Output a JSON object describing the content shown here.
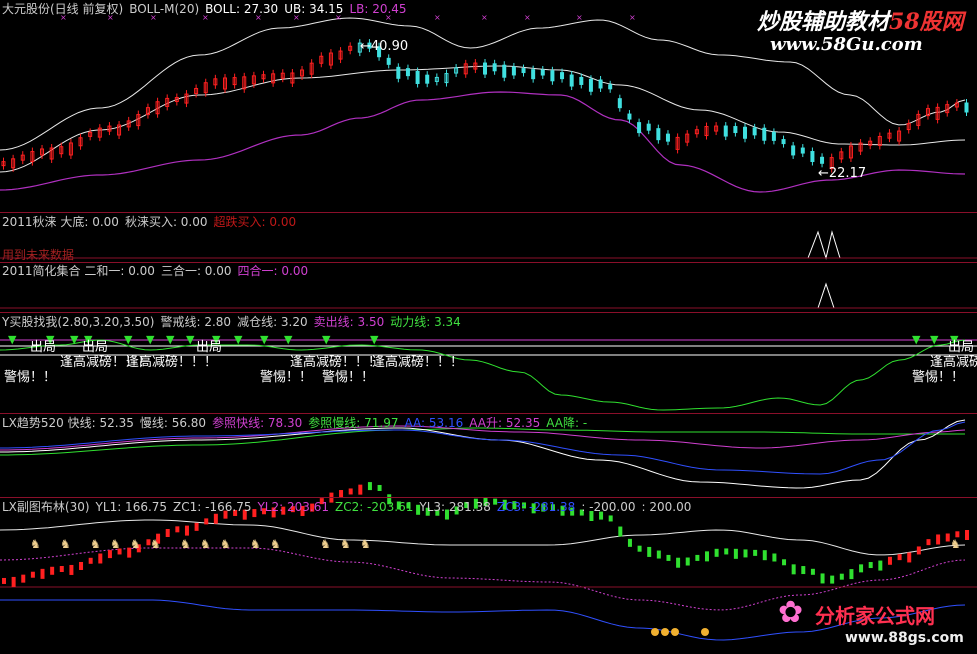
{
  "panels": [
    {
      "id": "main",
      "items": [
        {
          "text": "大元股份(日线 前复权)",
          "color": "#cccccc"
        },
        {
          "text": "BOLL-M(20)",
          "color": "#cccccc"
        },
        {
          "text": "BOLL: 27.30",
          "color": "#ffffff"
        },
        {
          "text": "UB: 34.15",
          "color": "#ffffff"
        },
        {
          "text": "LB: 20.45",
          "color": "#d040d0"
        }
      ]
    },
    {
      "id": "p2",
      "items": [
        {
          "text": "2011秋涞 大底: 0.00",
          "color": "#cccccc"
        },
        {
          "text": "秋涞买入: 0.00",
          "color": "#cccccc"
        },
        {
          "text": "超跌买入: 0.00",
          "color": "#c01818"
        }
      ]
    },
    {
      "id": "p2b",
      "items": [
        {
          "text": "用到未来数据",
          "color": "#a02020"
        }
      ]
    },
    {
      "id": "p3",
      "items": [
        {
          "text": "2011简化集合 二和一: 0.00",
          "color": "#cccccc"
        },
        {
          "text": "三合一: 0.00",
          "color": "#cccccc"
        },
        {
          "text": "四合一: 0.00",
          "color": "#d040d0"
        }
      ]
    },
    {
      "id": "p4",
      "items": [
        {
          "text": "Y买股找我(2.80,3.20,3.50)",
          "color": "#cccccc"
        },
        {
          "text": "警戒线: 2.80",
          "color": "#cccccc"
        },
        {
          "text": "减仓线: 3.20",
          "color": "#cccccc"
        },
        {
          "text": "卖出线: 3.50",
          "color": "#d040d0"
        },
        {
          "text": "动力线: 3.34",
          "color": "#40e040"
        }
      ]
    },
    {
      "id": "p5",
      "items": [
        {
          "text": "LX趋势520 快线: 52.35",
          "color": "#cccccc"
        },
        {
          "text": "慢线: 56.80",
          "color": "#cccccc"
        },
        {
          "text": "参照快线: 78.30",
          "color": "#d040d0"
        },
        {
          "text": "参照慢线: 71.97",
          "color": "#40e040"
        },
        {
          "text": "AA: 53.16",
          "color": "#3050ff"
        },
        {
          "text": "AA升: 52.35",
          "color": "#d040d0"
        },
        {
          "text": "AA降: -",
          "color": "#40e040"
        }
      ]
    },
    {
      "id": "p6",
      "items": [
        {
          "text": "LX副图布林(30)",
          "color": "#cccccc"
        },
        {
          "text": "YL1: 166.75",
          "color": "#cccccc"
        },
        {
          "text": "ZC1: -166.75",
          "color": "#cccccc"
        },
        {
          "text": "YL2: 203.61",
          "color": "#d040d0"
        },
        {
          "text": "ZC2: -203.61",
          "color": "#40e040"
        },
        {
          "text": "YL3: 281.38",
          "color": "#cccccc"
        },
        {
          "text": "ZC3: -281.38",
          "color": "#3050ff"
        },
        {
          "text": ": -200.00",
          "color": "#cccccc"
        },
        {
          "text": ": 200.00",
          "color": "#cccccc"
        }
      ]
    }
  ],
  "watermark": {
    "top": "炒股辅助教材",
    "top_accent": "58股网",
    "url1": "www.58Gu.com",
    "site": "分析家公式网",
    "url2": "www.88gs.com"
  },
  "annotations": {
    "high": "←40.90",
    "low": "←22.17",
    "out": "出局",
    "peak": "逢高减磅！！！",
    "warn": "警惕！！"
  },
  "chart_data": [
    {
      "type": "candlestick",
      "panel": "BOLL-M(20)",
      "series": [
        {
          "name": "BOLL",
          "value": 27.3
        },
        {
          "name": "UB",
          "value": 34.15
        },
        {
          "name": "LB",
          "value": 20.45
        }
      ],
      "price_marks": {
        "high": 40.9,
        "low": 22.17
      }
    },
    {
      "type": "line",
      "panel": "2011秋涞",
      "series": [
        {
          "name": "大底",
          "value": 0.0
        },
        {
          "name": "秋涞买入",
          "value": 0.0
        },
        {
          "name": "超跌买入",
          "value": 0.0
        }
      ]
    },
    {
      "type": "line",
      "panel": "2011简化集合",
      "series": [
        {
          "name": "二和一",
          "value": 0.0
        },
        {
          "name": "三合一",
          "value": 0.0
        },
        {
          "name": "四合一",
          "value": 0.0
        }
      ]
    },
    {
      "type": "line",
      "panel": "Y买股找我",
      "params": [
        2.8,
        3.2,
        3.5
      ],
      "series": [
        {
          "name": "警戒线",
          "value": 2.8
        },
        {
          "name": "减仓线",
          "value": 3.2
        },
        {
          "name": "卖出线",
          "value": 3.5
        },
        {
          "name": "动力线",
          "value": 3.34
        }
      ]
    },
    {
      "type": "line",
      "panel": "LX趋势520",
      "series": [
        {
          "name": "快线",
          "value": 52.35
        },
        {
          "name": "慢线",
          "value": 56.8
        },
        {
          "name": "参照快线",
          "value": 78.3
        },
        {
          "name": "参照慢线",
          "value": 71.97
        },
        {
          "name": "AA",
          "value": 53.16
        },
        {
          "name": "AA升",
          "value": 52.35
        }
      ]
    },
    {
      "type": "line",
      "panel": "LX副图布林(30)",
      "series": [
        {
          "name": "YL1",
          "value": 166.75
        },
        {
          "name": "ZC1",
          "value": -166.75
        },
        {
          "name": "YL2",
          "value": 203.61
        },
        {
          "name": "ZC2",
          "value": -203.61
        },
        {
          "name": "YL3",
          "value": 281.38
        },
        {
          "name": "ZC3",
          "value": -281.38
        }
      ],
      "levels": [
        -200.0,
        200.0
      ]
    }
  ],
  "colors": {
    "up": "#ff2020",
    "down": "#40e0e0",
    "mid": "#ffffff",
    "lower": "#b030c0",
    "sep": "#8a0f2a",
    "green": "#30e030"
  }
}
